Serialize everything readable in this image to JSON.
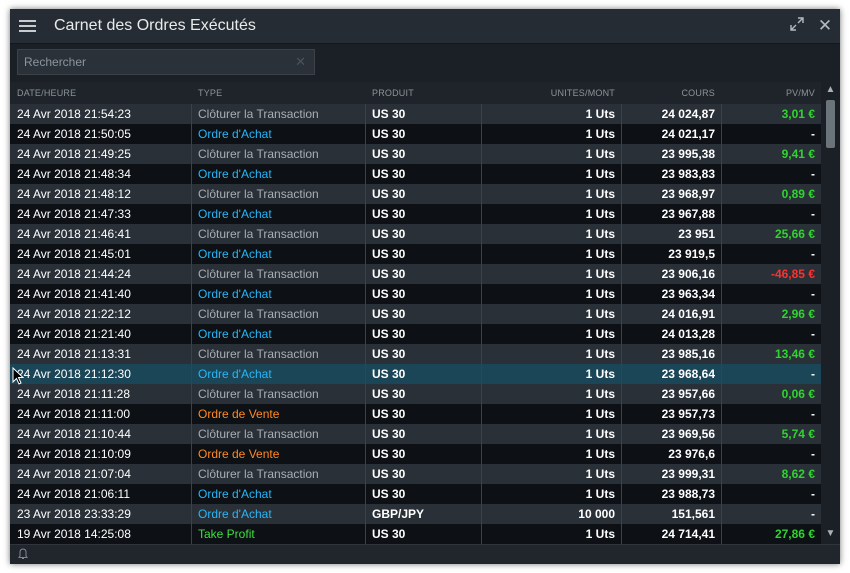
{
  "window": {
    "title": "Carnet des Ordres Exécutés"
  },
  "search": {
    "placeholder": "Rechercher"
  },
  "columns": {
    "date": "DATE/HEURE",
    "type": "TYPE",
    "product": "PRODUIT",
    "units": "UNITES/MONT",
    "price": "COURS",
    "pl": "PV/MV"
  },
  "colors": {
    "close": "#a8aeb4",
    "buy": "#29b6f6",
    "sell": "#ff8a24",
    "takeprofit": "#3ee03e",
    "positive": "#2fd42f",
    "negative": "#ff3030",
    "neutral": "#ffffff"
  },
  "selected_row": 13,
  "rows": [
    {
      "date": "24 Avr 2018 21:54:23",
      "type": "Clôturer la Transaction",
      "kind": "close",
      "product": "US 30",
      "units": "1 Uts",
      "price": "24 024,87",
      "pl": "3,01 €",
      "pl_sign": "positive"
    },
    {
      "date": "24 Avr 2018 21:50:05",
      "type": "Ordre d'Achat",
      "kind": "buy",
      "product": "US 30",
      "units": "1 Uts",
      "price": "24 021,17",
      "pl": "-",
      "pl_sign": "neutral"
    },
    {
      "date": "24 Avr 2018 21:49:25",
      "type": "Clôturer la Transaction",
      "kind": "close",
      "product": "US 30",
      "units": "1 Uts",
      "price": "23 995,38",
      "pl": "9,41 €",
      "pl_sign": "positive"
    },
    {
      "date": "24 Avr 2018 21:48:34",
      "type": "Ordre d'Achat",
      "kind": "buy",
      "product": "US 30",
      "units": "1 Uts",
      "price": "23 983,83",
      "pl": "-",
      "pl_sign": "neutral"
    },
    {
      "date": "24 Avr 2018 21:48:12",
      "type": "Clôturer la Transaction",
      "kind": "close",
      "product": "US 30",
      "units": "1 Uts",
      "price": "23 968,97",
      "pl": "0,89 €",
      "pl_sign": "positive"
    },
    {
      "date": "24 Avr 2018 21:47:33",
      "type": "Ordre d'Achat",
      "kind": "buy",
      "product": "US 30",
      "units": "1 Uts",
      "price": "23 967,88",
      "pl": "-",
      "pl_sign": "neutral"
    },
    {
      "date": "24 Avr 2018 21:46:41",
      "type": "Clôturer la Transaction",
      "kind": "close",
      "product": "US 30",
      "units": "1 Uts",
      "price": "23 951",
      "pl": "25,66 €",
      "pl_sign": "positive"
    },
    {
      "date": "24 Avr 2018 21:45:01",
      "type": "Ordre d'Achat",
      "kind": "buy",
      "product": "US 30",
      "units": "1 Uts",
      "price": "23 919,5",
      "pl": "-",
      "pl_sign": "neutral"
    },
    {
      "date": "24 Avr 2018 21:44:24",
      "type": "Clôturer la Transaction",
      "kind": "close",
      "product": "US 30",
      "units": "1 Uts",
      "price": "23 906,16",
      "pl": "-46,85 €",
      "pl_sign": "negative"
    },
    {
      "date": "24 Avr 2018 21:41:40",
      "type": "Ordre d'Achat",
      "kind": "buy",
      "product": "US 30",
      "units": "1 Uts",
      "price": "23 963,34",
      "pl": "-",
      "pl_sign": "neutral"
    },
    {
      "date": "24 Avr 2018 21:22:12",
      "type": "Clôturer la Transaction",
      "kind": "close",
      "product": "US 30",
      "units": "1 Uts",
      "price": "24 016,91",
      "pl": "2,96 €",
      "pl_sign": "positive"
    },
    {
      "date": "24 Avr 2018 21:21:40",
      "type": "Ordre d'Achat",
      "kind": "buy",
      "product": "US 30",
      "units": "1 Uts",
      "price": "24 013,28",
      "pl": "-",
      "pl_sign": "neutral"
    },
    {
      "date": "24 Avr 2018 21:13:31",
      "type": "Clôturer la Transaction",
      "kind": "close",
      "product": "US 30",
      "units": "1 Uts",
      "price": "23 985,16",
      "pl": "13,46 €",
      "pl_sign": "positive"
    },
    {
      "date": "24 Avr 2018 21:12:30",
      "type": "Ordre d'Achat",
      "kind": "buy",
      "product": "US 30",
      "units": "1 Uts",
      "price": "23 968,64",
      "pl": "-",
      "pl_sign": "neutral"
    },
    {
      "date": "24 Avr 2018 21:11:28",
      "type": "Clôturer la Transaction",
      "kind": "close",
      "product": "US 30",
      "units": "1 Uts",
      "price": "23 957,66",
      "pl": "0,06 €",
      "pl_sign": "positive"
    },
    {
      "date": "24 Avr 2018 21:11:00",
      "type": "Ordre de Vente",
      "kind": "sell",
      "product": "US 30",
      "units": "1 Uts",
      "price": "23 957,73",
      "pl": "-",
      "pl_sign": "neutral"
    },
    {
      "date": "24 Avr 2018 21:10:44",
      "type": "Clôturer la Transaction",
      "kind": "close",
      "product": "US 30",
      "units": "1 Uts",
      "price": "23 969,56",
      "pl": "5,74 €",
      "pl_sign": "positive"
    },
    {
      "date": "24 Avr 2018 21:10:09",
      "type": "Ordre de Vente",
      "kind": "sell",
      "product": "US 30",
      "units": "1 Uts",
      "price": "23 976,6",
      "pl": "-",
      "pl_sign": "neutral"
    },
    {
      "date": "24 Avr 2018 21:07:04",
      "type": "Clôturer la Transaction",
      "kind": "close",
      "product": "US 30",
      "units": "1 Uts",
      "price": "23 999,31",
      "pl": "8,62 €",
      "pl_sign": "positive"
    },
    {
      "date": "24 Avr 2018 21:06:11",
      "type": "Ordre d'Achat",
      "kind": "buy",
      "product": "US 30",
      "units": "1 Uts",
      "price": "23 988,73",
      "pl": "-",
      "pl_sign": "neutral"
    },
    {
      "date": "23 Avr 2018 23:33:29",
      "type": "Ordre d'Achat",
      "kind": "buy",
      "product": "GBP/JPY",
      "units": "10 000",
      "price": "151,561",
      "pl": "-",
      "pl_sign": "neutral"
    },
    {
      "date": "19 Avr 2018 14:25:08",
      "type": "Take Profit",
      "kind": "takeprofit",
      "product": "US 30",
      "units": "1 Uts",
      "price": "24 714,41",
      "pl": "27,86 €",
      "pl_sign": "positive"
    }
  ]
}
